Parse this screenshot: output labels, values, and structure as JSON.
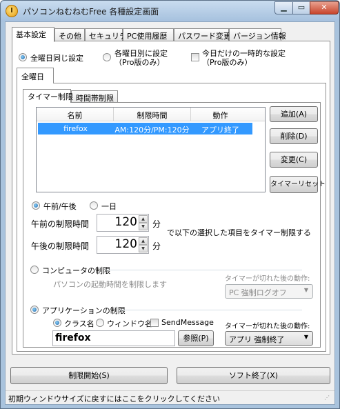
{
  "window": {
    "title": "パソコンねむねむFree 各種設定画面",
    "minimize_glyph": "▁",
    "maximize_glyph": "▭",
    "close_glyph": "✕"
  },
  "tabs": [
    {
      "label": "基本設定"
    },
    {
      "label": "その他"
    },
    {
      "label": "セキュリティ"
    },
    {
      "label": "PC使用履歴"
    },
    {
      "label": "パスワード変更"
    },
    {
      "label": "バージョン情報"
    }
  ],
  "mode": {
    "all_days_label": "全曜日同じ設定",
    "per_day_label": "各曜日別に設定",
    "per_day_note": "（Pro版のみ）",
    "today_only_label": "今日だけの一時的な設定",
    "today_only_note": "（Pro版のみ）"
  },
  "day_tab": {
    "label": "全曜日"
  },
  "subtabs": [
    {
      "label": "タイマー制限"
    },
    {
      "label": "時間帯制限"
    }
  ],
  "list": {
    "columns": [
      "名前",
      "制限時間",
      "動作"
    ],
    "rows": [
      {
        "name": "firefox",
        "limit": "AM:120分/PM:120分",
        "action": "アプリ終了"
      }
    ]
  },
  "side_buttons": {
    "add": "追加(A)",
    "delete": "削除(D)",
    "change": "変更(C)",
    "reset": "タイマーリセット"
  },
  "ampm": {
    "ampm_label": "午前/午後",
    "allday_label": "一日",
    "am_limit_label": "午前の制限時間",
    "am_value": "120",
    "pm_limit_label": "午後の制限時間",
    "pm_value": "120",
    "unit": "分",
    "note": "で以下の選択した項目をタイマー制限する"
  },
  "computer_limit": {
    "label": "コンピュータの制限",
    "description": "パソコンの起動時間を制限します",
    "after_label": "タイマーが切れた後の動作:",
    "after_value": "PC 強制ログオフ"
  },
  "app_limit": {
    "label": "アプリケーションの制限",
    "class_label": "クラス名",
    "window_label": "ウィンドウ名",
    "sendmessage_label": "SendMessage",
    "after_label": "タイマーが切れた後の動作:",
    "app_name": "firefox",
    "browse_label": "参照(P)",
    "after_value": "アプリ 強制終了"
  },
  "bottom_buttons": {
    "start": "制限開始(S)",
    "exit": "ソフト終了(X)"
  },
  "status": {
    "text": "初期ウィンドウサイズに戻すにはここをクリックしてください"
  }
}
